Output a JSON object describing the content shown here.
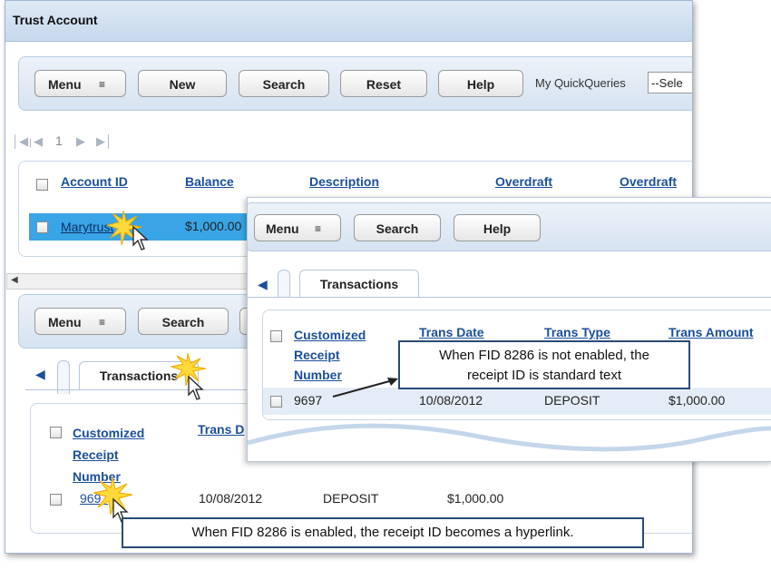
{
  "window": {
    "title": "Trust Account"
  },
  "toolbar1": {
    "menu": "Menu",
    "new": "New",
    "search": "Search",
    "reset": "Reset",
    "help": "Help",
    "quickqueries_label": "My QuickQueries",
    "quickqueries_value": "--Sele"
  },
  "pager": {
    "page": "1"
  },
  "accounts": {
    "headers": [
      "Account ID",
      "Balance",
      "Description",
      "Overdraft",
      "Overdraft"
    ],
    "row": {
      "account_id": "Marytrust",
      "balance": "$1,000.00"
    }
  },
  "toolbar2": {
    "menu": "Menu",
    "search": "Search"
  },
  "tabs": {
    "transactions": "Transactions"
  },
  "transactions": {
    "headers": [
      "Customized Receipt Number",
      "Trans D",
      "Trans Date",
      "Trans Type",
      "Trans Amount"
    ],
    "header_receipt_lines": [
      "Customized",
      "Receipt",
      "Number"
    ],
    "row": {
      "receipt": "9697",
      "date": "10/08/2012",
      "type": "DEPOSIT",
      "amount": "$1,000.00"
    }
  },
  "popup": {
    "menu": "Menu",
    "search": "Search",
    "help": "Help",
    "tab": "Transactions"
  },
  "callouts": {
    "not_enabled_line1": "When FID 8286 is not enabled, the",
    "not_enabled_line2": "receipt ID is standard text",
    "enabled": "When FID 8286 is enabled, the receipt ID becomes a hyperlink."
  },
  "colors": {
    "accent": "#1c4f9c",
    "selected_row": "#39a5e6",
    "toolbar": "#dce7f3"
  }
}
